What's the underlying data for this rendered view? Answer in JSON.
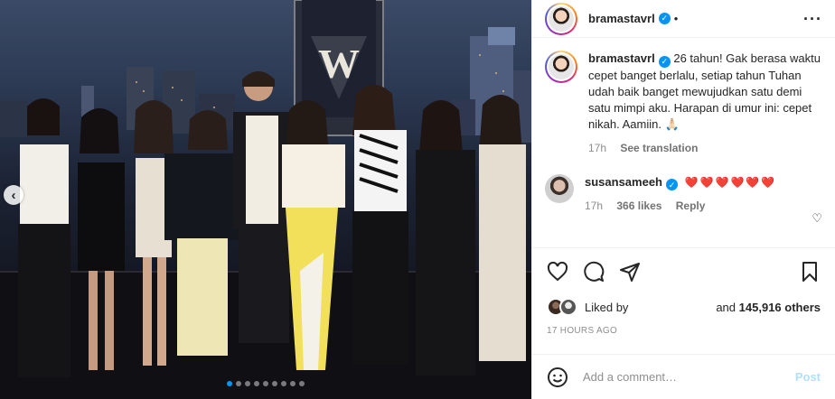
{
  "post": {
    "author": "bramastavrl",
    "caption": "26 tahun! Gak berasa waktu cepet banget berlalu, setiap tahun Tuhan udah baik banget mewujudkan satu demi satu mimpi aku. Harapan di umur ini: cepet nikah. Aamiin. 🙏🏻",
    "caption_age": "17h",
    "see_translation": "See translation",
    "photo_description_sign": "W"
  },
  "comment": {
    "author": "susansameeh",
    "text": "❤️❤️❤️❤️❤️❤️",
    "age": "17h",
    "likes": "366 likes",
    "reply": "Reply"
  },
  "likes_row": {
    "liked_by": "Liked by",
    "and_prefix": "and",
    "count": "145,916 others"
  },
  "timestamp": "17 HOURS AGO",
  "add_comment": {
    "placeholder": "Add a comment…",
    "post_label": "Post"
  },
  "carousel": {
    "slides": 9,
    "active_index": 0
  },
  "colors": {
    "accent": "#0095f6",
    "heart": "#ed4956",
    "muted": "#8e8e8e"
  },
  "icons": [
    "chevron-left-icon",
    "more-icon",
    "verified-icon",
    "heart-icon",
    "comment-icon",
    "share-icon",
    "bookmark-icon",
    "emoji-icon"
  ]
}
